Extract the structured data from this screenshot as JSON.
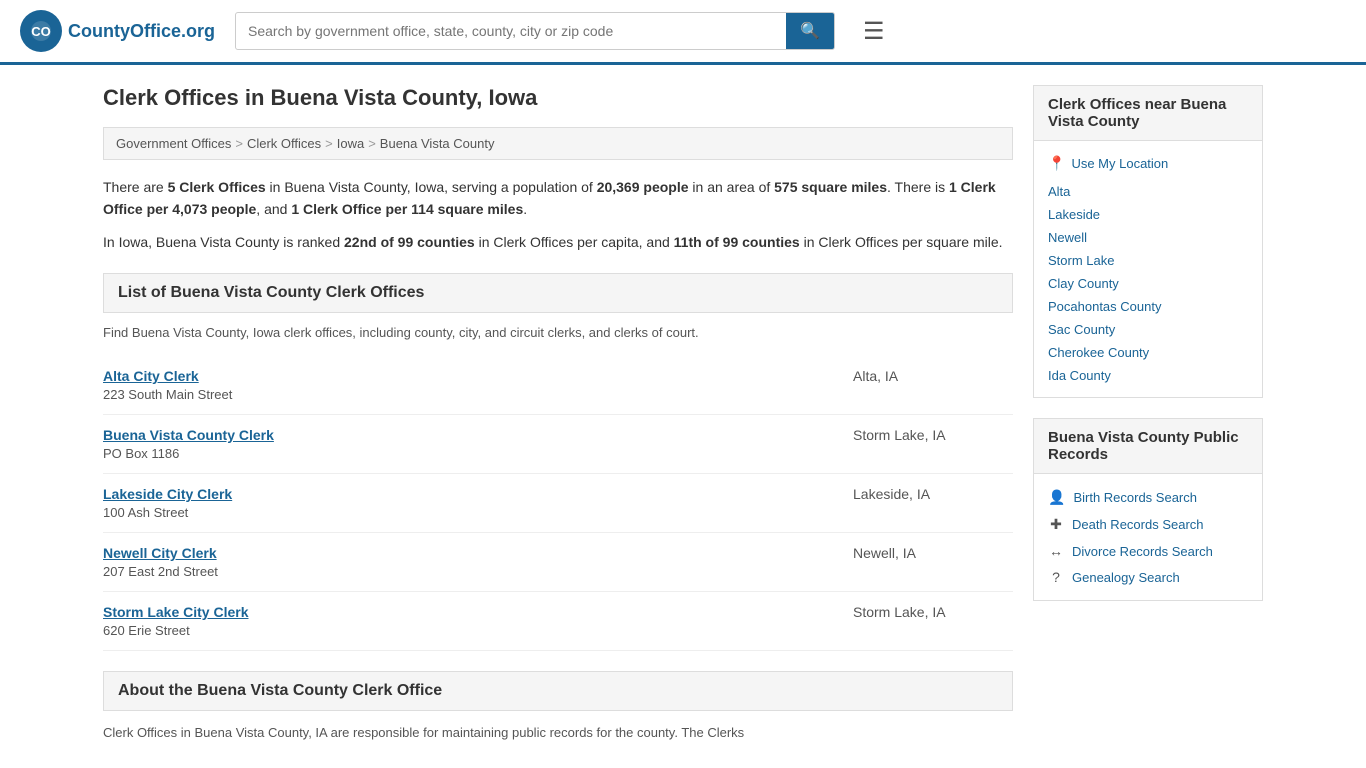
{
  "header": {
    "logo_text": "CountyOffice",
    "logo_suffix": ".org",
    "search_placeholder": "Search by government office, state, county, city or zip code",
    "search_icon": "🔍",
    "menu_icon": "☰"
  },
  "page": {
    "title": "Clerk Offices in Buena Vista County, Iowa",
    "breadcrumbs": [
      {
        "label": "Government Offices",
        "href": "#"
      },
      {
        "label": "Clerk Offices",
        "href": "#"
      },
      {
        "label": "Iowa",
        "href": "#"
      },
      {
        "label": "Buena Vista County",
        "href": "#"
      }
    ],
    "description_1": "There are 5 Clerk Offices in Buena Vista County, Iowa, serving a population of 20,369 people in an area of 575 square miles. There is 1 Clerk Office per 4,073 people, and 1 Clerk Office per 114 square miles.",
    "description_2": "In Iowa, Buena Vista County is ranked 22nd of 99 counties in Clerk Offices per capita, and 11th of 99 counties in Clerk Offices per square mile.",
    "list_section_title": "List of Buena Vista County Clerk Offices",
    "list_description": "Find Buena Vista County, Iowa clerk offices, including county, city, and circuit clerks, and clerks of court.",
    "about_section_title": "About the Buena Vista County Clerk Office",
    "about_text": "Clerk Offices in Buena Vista County, IA are responsible for maintaining public records for the county. The Clerks"
  },
  "clerks": [
    {
      "name": "Alta City Clerk",
      "address": "223 South Main Street",
      "city": "Alta, IA"
    },
    {
      "name": "Buena Vista County Clerk",
      "address": "PO Box 1186",
      "city": "Storm Lake, IA"
    },
    {
      "name": "Lakeside City Clerk",
      "address": "100 Ash Street",
      "city": "Lakeside, IA"
    },
    {
      "name": "Newell City Clerk",
      "address": "207 East 2nd Street",
      "city": "Newell, IA"
    },
    {
      "name": "Storm Lake City Clerk",
      "address": "620 Erie Street",
      "city": "Storm Lake, IA"
    }
  ],
  "sidebar": {
    "nearby_section_title": "Clerk Offices near Buena Vista County",
    "use_location_label": "Use My Location",
    "nearby_links": [
      "Alta",
      "Lakeside",
      "Newell",
      "Storm Lake",
      "Clay County",
      "Pocahontas County",
      "Sac County",
      "Cherokee County",
      "Ida County"
    ],
    "public_records_title": "Buena Vista County Public Records",
    "public_records": [
      {
        "label": "Birth Records Search",
        "icon": "👤"
      },
      {
        "label": "Death Records Search",
        "icon": "✚"
      },
      {
        "label": "Divorce Records Search",
        "icon": "↔"
      },
      {
        "label": "Genealogy Search",
        "icon": "?"
      }
    ]
  }
}
